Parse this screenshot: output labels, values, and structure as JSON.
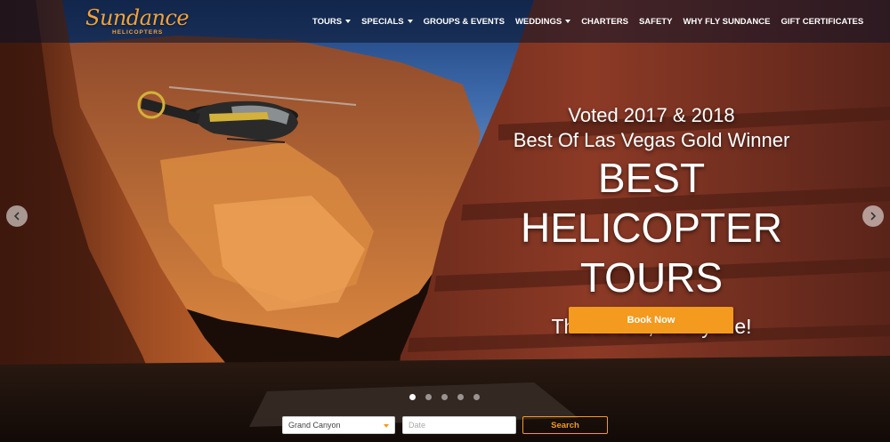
{
  "brand": {
    "name": "Sundance",
    "tagline": "HELICOPTERS",
    "accent_color": "#f39a1f"
  },
  "nav": {
    "items": [
      {
        "label": "TOURS",
        "dropdown": true
      },
      {
        "label": "SPECIALS",
        "dropdown": true
      },
      {
        "label": "GROUPS & EVENTS",
        "dropdown": false
      },
      {
        "label": "WEDDINGS",
        "dropdown": true
      },
      {
        "label": "CHARTERS",
        "dropdown": false
      },
      {
        "label": "SAFETY",
        "dropdown": false
      },
      {
        "label": "WHY FLY SUNDANCE",
        "dropdown": false
      },
      {
        "label": "GIFT CERTIFICATES",
        "dropdown": false
      }
    ]
  },
  "hero": {
    "voted": "Voted 2017 & 2018",
    "award": "Best Of Las Vegas Gold Winner",
    "title_line1": "BEST HELICOPTER",
    "title_line2": "TOURS",
    "thanks": "Thank You, Everyone!",
    "cta_label": "Book Now"
  },
  "carousel": {
    "prev_icon": "chevron-left-icon",
    "next_icon": "chevron-right-icon",
    "slide_count": 5,
    "active_index": 0
  },
  "search": {
    "destination_value": "Grand Canyon",
    "date_placeholder": "Date",
    "button_label": "Search"
  }
}
